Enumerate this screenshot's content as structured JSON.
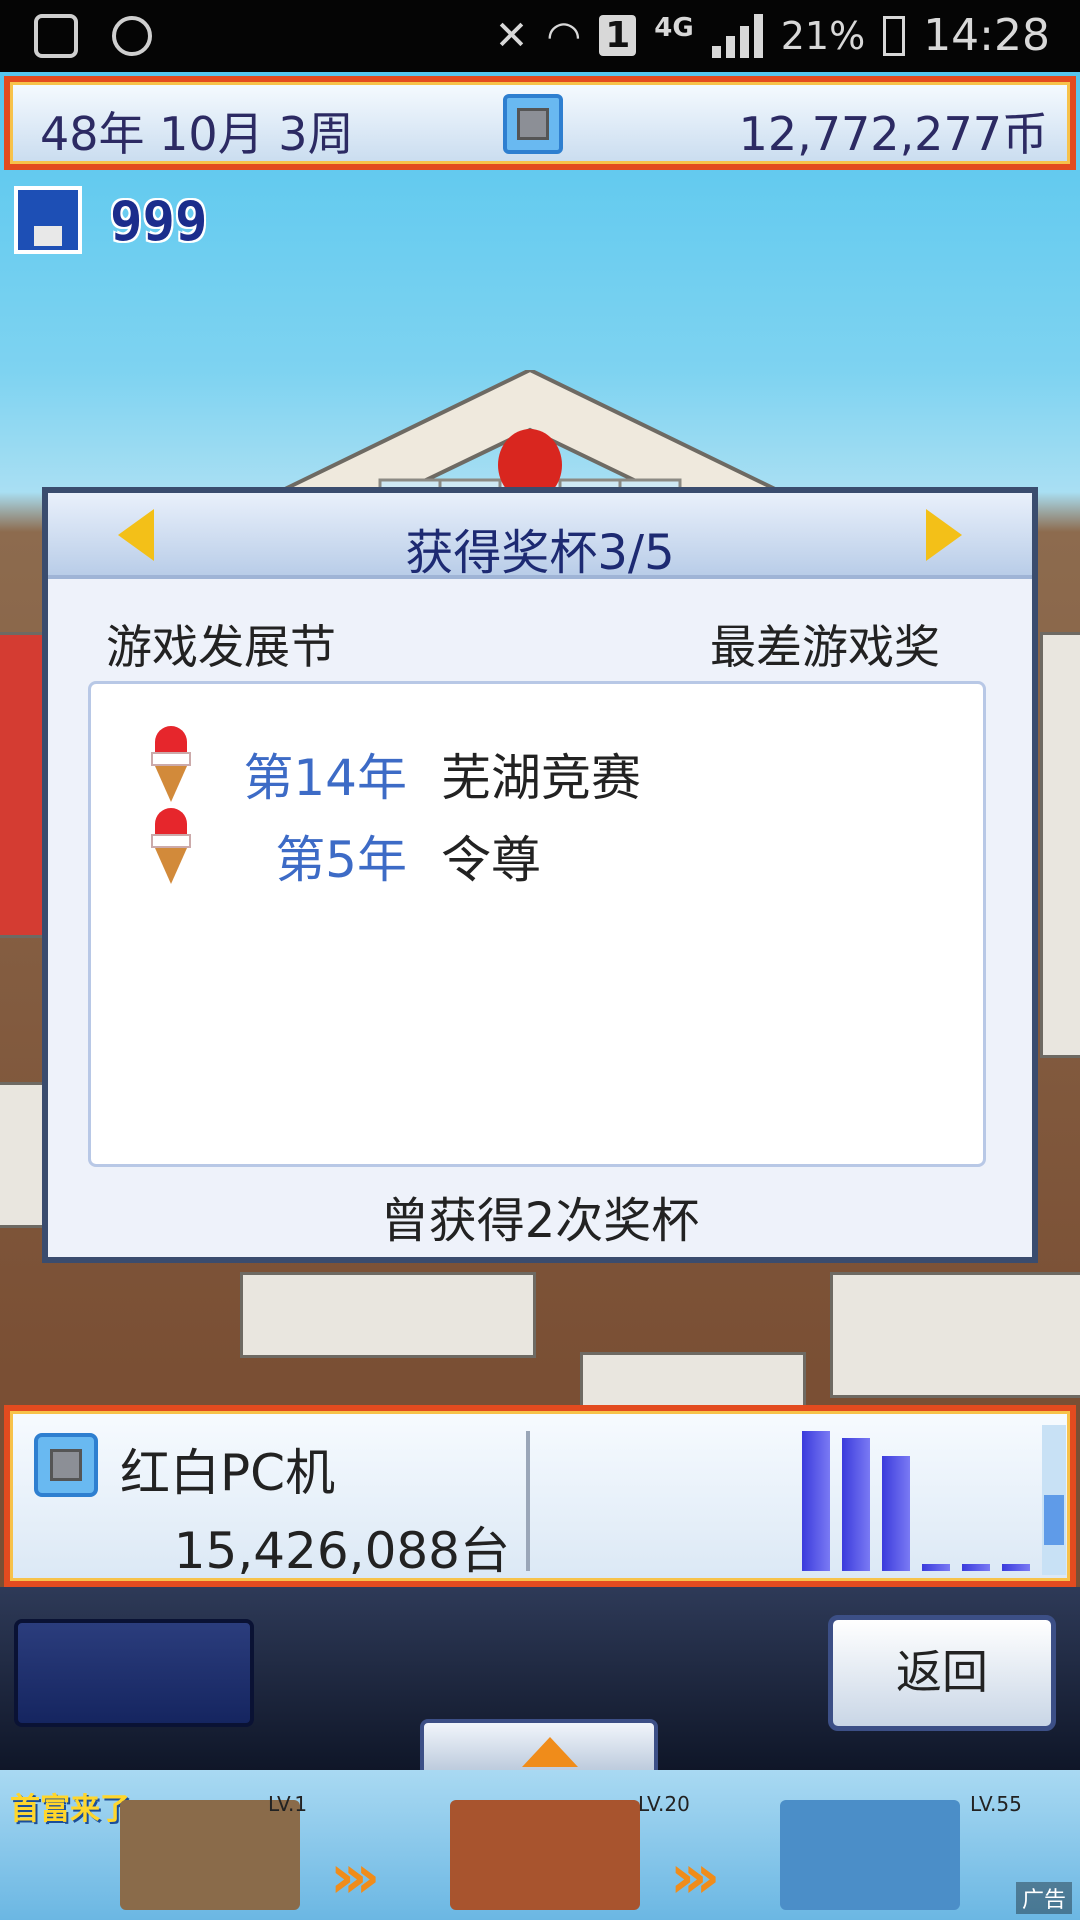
{
  "status_bar": {
    "battery": "21%",
    "time": "14:28",
    "network": "4G",
    "sim_slot": "1"
  },
  "hud": {
    "date": "48年 10月 3周",
    "money": "12,772,277币",
    "save_count": "999"
  },
  "dialog": {
    "title": "获得奖杯3/5",
    "festival": "游戏发展节",
    "award_category": "最差游戏奖",
    "entries": [
      {
        "year": "第14年",
        "game": "芜湖竞赛"
      },
      {
        "year": "第5年",
        "game": "令尊"
      }
    ],
    "footer": "曾获得2次奖杯"
  },
  "info_panel": {
    "console_name": "红白PC机",
    "units_sold": "15,426,088台",
    "sales_bars": [
      1.0,
      0.95,
      0.82,
      0.05,
      0.05,
      0.05
    ]
  },
  "controls": {
    "back_label": "返回"
  },
  "ad_banner": {
    "brand": "首富来了",
    "levels": [
      "LV.1",
      "LV.20",
      "LV.55"
    ],
    "tag": "广告"
  },
  "colors": {
    "hud_border": "#e34b1f",
    "dialog_title": "#1d2a72",
    "year_text": "#3d6bc6",
    "sales_bar": "#3b3bdc"
  }
}
